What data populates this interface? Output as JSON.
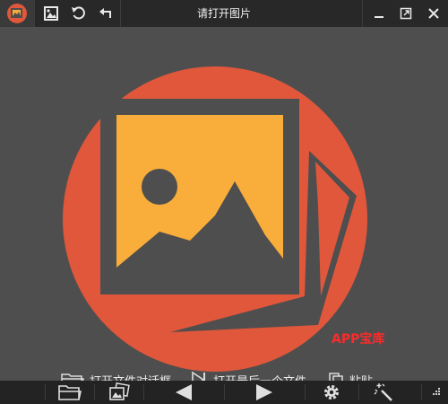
{
  "window": {
    "title": "请打开图片",
    "icons": {
      "app": "app-logo-icon",
      "gallery": "gallery-icon",
      "rotate": "rotate-left-icon",
      "undo": "undo-icon",
      "minimize": "minimize-icon",
      "expand": "expand-icon",
      "close": "close-icon"
    }
  },
  "main": {
    "open_dialog_label": "打开文件对话框",
    "open_last_label": "打开最后一个文件",
    "paste_label": "粘贴"
  },
  "watermark": "APP宝库",
  "toolbar": {
    "items": [
      "folder-icon",
      "open-images-icon",
      "previous-icon",
      "next-icon",
      "settings-icon",
      "magic-wand-icon",
      "grid-icon"
    ]
  },
  "colors": {
    "accent": "#e0573b",
    "photo": "#f9ad3b",
    "background": "#4e4e4e",
    "titlebar": "#282828"
  }
}
